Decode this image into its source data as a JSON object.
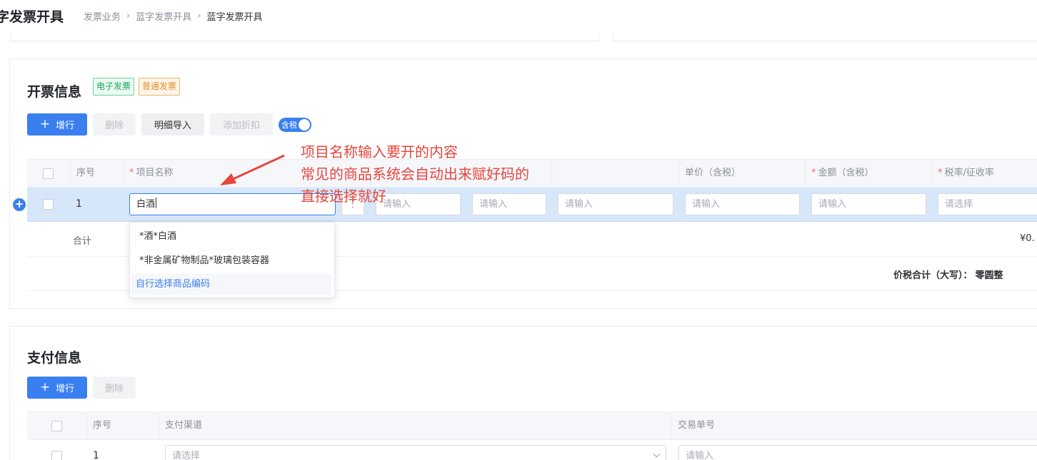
{
  "header": {
    "title": "字发票开具",
    "breadcrumb": [
      "发票业务",
      "蓝字发票开具",
      "蓝字发票开具"
    ]
  },
  "invoice_section": {
    "title": "开票信息",
    "tags": [
      "电子发票",
      "普通发票"
    ],
    "buttons": {
      "add": "增行",
      "delete": "删除",
      "import": "明细导入",
      "discount": "添加折扣"
    },
    "tax_switch_label": "含税",
    "columns": [
      "序号",
      "项目名称",
      "单价（含税）",
      "金额（含税）",
      "税率/征收率"
    ],
    "row": {
      "index": "1",
      "item_name": "白酒",
      "placeholder_input": "请输入",
      "placeholder_select": "请选择"
    },
    "subtotal_label": "合计",
    "subtotal_amount": "¥0.",
    "total_label": "价税合计（大写）：",
    "total_value": "零圆整"
  },
  "suggestions": {
    "items": [
      "*酒*白酒",
      "*非金属矿物制品*玻璃包装容器"
    ],
    "custom_link": "自行选择商品编码"
  },
  "annotation": {
    "lines": [
      "项目名称输入要开的内容",
      "常见的商品系统会自动出来赋好码的",
      "直接选择就好"
    ]
  },
  "payment_section": {
    "title": "支付信息",
    "buttons": {
      "add": "增行",
      "delete": "删除"
    },
    "columns": [
      "序号",
      "支付渠道",
      "交易单号"
    ],
    "row": {
      "index": "1",
      "channel_placeholder": "请选择",
      "txn_placeholder": "请输入"
    }
  },
  "colors": {
    "primary": "#3a7ff0",
    "annotation": "#e8453c",
    "selected_row": "#d7e7fa"
  }
}
